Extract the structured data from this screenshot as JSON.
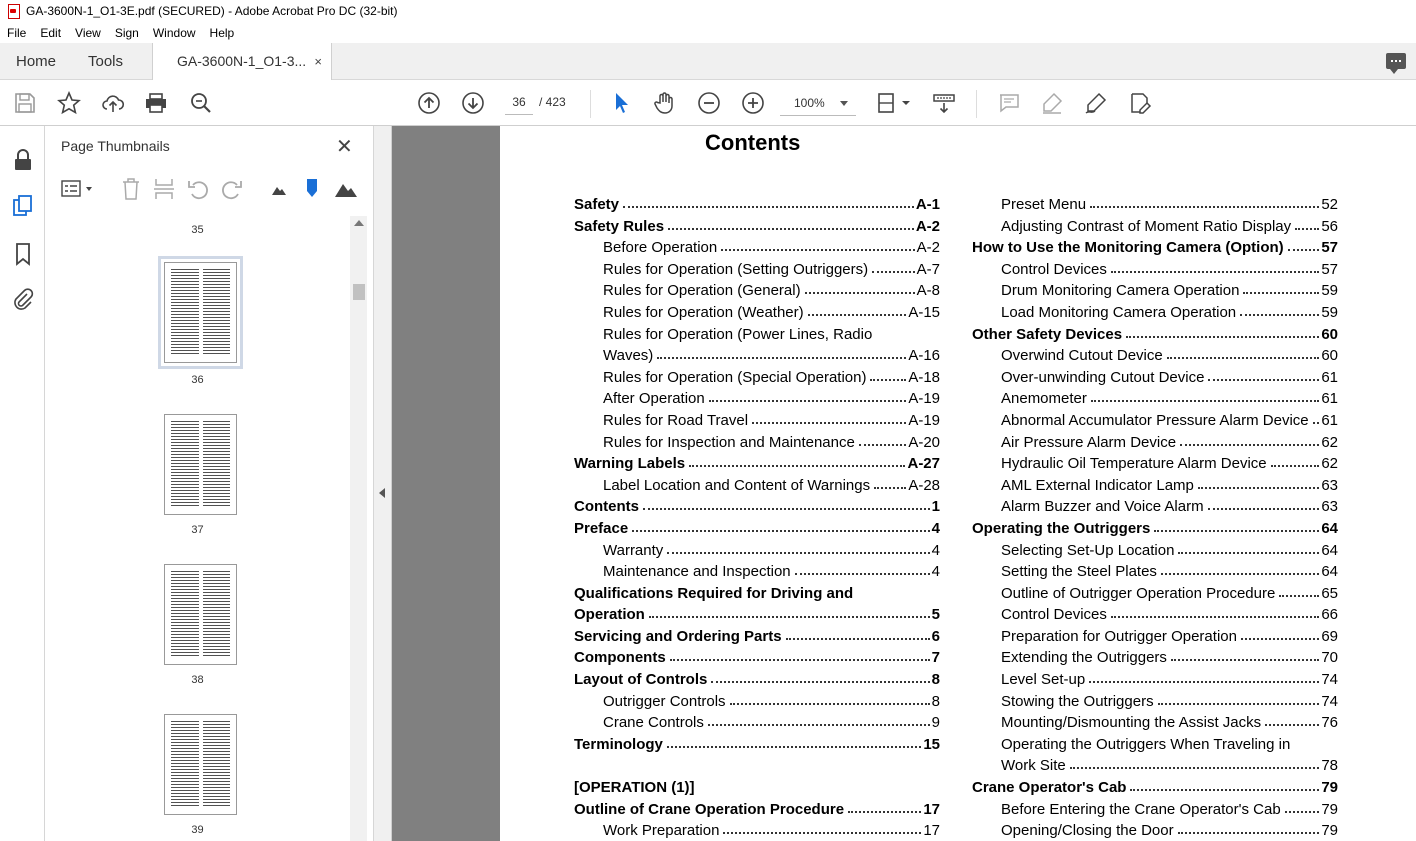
{
  "window": {
    "title": "GA-3600N-1_O1-3E.pdf (SECURED) - Adobe Acrobat Pro DC (32-bit)"
  },
  "menu": [
    "File",
    "Edit",
    "View",
    "Sign",
    "Window",
    "Help"
  ],
  "tabs": {
    "home": "Home",
    "tools": "Tools",
    "document": "GA-3600N-1_O1-3...",
    "close": "×"
  },
  "toolbar": {
    "page_current": "36",
    "page_total": "/ 423",
    "zoom": "100%"
  },
  "thumbnails": {
    "title": "Page Thumbnails",
    "close": "✕",
    "pages": [
      {
        "label": "35"
      },
      {
        "label": "36",
        "selected": true
      },
      {
        "label": "37"
      },
      {
        "label": "38"
      },
      {
        "label": "39"
      }
    ]
  },
  "document": {
    "heading": "Contents",
    "left_entries": [
      {
        "title": "Safety",
        "page": "A-1",
        "bold": true
      },
      {
        "title": "Safety Rules",
        "page": "A-2",
        "bold": true
      },
      {
        "title": "Before Operation",
        "page": "A-2",
        "indent": true
      },
      {
        "title": "Rules for Operation (Setting Outriggers)",
        "page": "A-7",
        "indent": true
      },
      {
        "title": "Rules for Operation (General)",
        "page": "A-8",
        "indent": true
      },
      {
        "title": "Rules for Operation (Weather)",
        "page": "A-15",
        "indent": true
      },
      {
        "title": "Rules for Operation (Power Lines, Radio",
        "page": "",
        "indent": true,
        "nodots": true
      },
      {
        "title": "Waves)",
        "page": "A-16",
        "indent": true
      },
      {
        "title": "Rules for Operation (Special Operation)",
        "page": "A-18",
        "indent": true
      },
      {
        "title": "After Operation",
        "page": "A-19",
        "indent": true
      },
      {
        "title": "Rules for Road Travel",
        "page": "A-19",
        "indent": true
      },
      {
        "title": "Rules for Inspection and Maintenance",
        "page": "A-20",
        "indent": true
      },
      {
        "title": "Warning Labels",
        "page": "A-27",
        "bold": true
      },
      {
        "title": "Label Location and Content of Warnings",
        "page": "A-28",
        "indent": true
      },
      {
        "title": "Contents",
        "page": "1",
        "bold": true
      },
      {
        "title": "Preface",
        "page": "4",
        "bold": true
      },
      {
        "title": "Warranty",
        "page": "4",
        "indent": true
      },
      {
        "title": "Maintenance and Inspection",
        "page": "4",
        "indent": true
      },
      {
        "title": "Qualifications Required for Driving and",
        "page": "",
        "bold": true,
        "nodots": true
      },
      {
        "title": "Operation",
        "page": "5",
        "bold": true
      },
      {
        "title": "Servicing and Ordering Parts",
        "page": "6",
        "bold": true
      },
      {
        "title": "Components",
        "page": "7",
        "bold": true
      },
      {
        "title": "Layout of Controls",
        "page": "8",
        "bold": true
      },
      {
        "title": "Outrigger Controls",
        "page": "8",
        "indent": true
      },
      {
        "title": "Crane Controls",
        "page": "9",
        "indent": true
      },
      {
        "title": "Terminology",
        "page": "15",
        "bold": true
      },
      {
        "title": "",
        "page": "",
        "nodots": true
      },
      {
        "title": "[OPERATION (1)]",
        "page": "",
        "bold": true,
        "nodots": true
      },
      {
        "title": "Outline of Crane Operation Procedure",
        "page": "17",
        "bold": true
      },
      {
        "title": "Work Preparation",
        "page": "17",
        "indent": true
      }
    ],
    "right_entries": [
      {
        "title": "Preset Menu",
        "page": "52",
        "indent": true
      },
      {
        "title": "Adjusting Contrast of Moment Ratio Display",
        "page": "56",
        "indent": true
      },
      {
        "title": "How to Use the Monitoring Camera (Option)",
        "page": "57",
        "bold": true
      },
      {
        "title": "Control Devices",
        "page": "57",
        "indent": true
      },
      {
        "title": "Drum Monitoring Camera Operation",
        "page": "59",
        "indent": true
      },
      {
        "title": "Load Monitoring Camera Operation",
        "page": "59",
        "indent": true
      },
      {
        "title": "Other Safety Devices",
        "page": "60",
        "bold": true
      },
      {
        "title": "Overwind Cutout Device",
        "page": "60",
        "indent": true
      },
      {
        "title": "Over-unwinding Cutout Device",
        "page": "61",
        "indent": true
      },
      {
        "title": "Anemometer",
        "page": "61",
        "indent": true
      },
      {
        "title": "Abnormal Accumulator Pressure Alarm Device",
        "page": "61",
        "indent": true
      },
      {
        "title": "Air Pressure Alarm Device",
        "page": "62",
        "indent": true
      },
      {
        "title": "Hydraulic Oil Temperature Alarm Device",
        "page": "62",
        "indent": true
      },
      {
        "title": "AML External Indicator Lamp",
        "page": "63",
        "indent": true
      },
      {
        "title": "Alarm Buzzer and Voice Alarm",
        "page": "63",
        "indent": true
      },
      {
        "title": "Operating the Outriggers",
        "page": "64",
        "bold": true
      },
      {
        "title": "Selecting Set-Up Location",
        "page": "64",
        "indent": true
      },
      {
        "title": "Setting the Steel Plates",
        "page": "64",
        "indent": true
      },
      {
        "title": "Outline of Outrigger Operation Procedure",
        "page": "65",
        "indent": true
      },
      {
        "title": "Control Devices",
        "page": "66",
        "indent": true
      },
      {
        "title": "Preparation for Outrigger Operation",
        "page": "69",
        "indent": true
      },
      {
        "title": "Extending the Outriggers",
        "page": "70",
        "indent": true
      },
      {
        "title": "Level Set-up",
        "page": "74",
        "indent": true
      },
      {
        "title": "Stowing the Outriggers",
        "page": "74",
        "indent": true
      },
      {
        "title": "Mounting/Dismounting the Assist Jacks",
        "page": "76",
        "indent": true
      },
      {
        "title": "Operating the Outriggers When Traveling in",
        "page": "",
        "indent": true,
        "nodots": true
      },
      {
        "title": "Work Site",
        "page": "78",
        "indent": true
      },
      {
        "title": "Crane Operator's Cab",
        "page": "79",
        "bold": true
      },
      {
        "title": "Before Entering the Crane Operator's Cab",
        "page": "79",
        "indent": true
      },
      {
        "title": "Opening/Closing the Door",
        "page": "79",
        "indent": true
      }
    ]
  }
}
